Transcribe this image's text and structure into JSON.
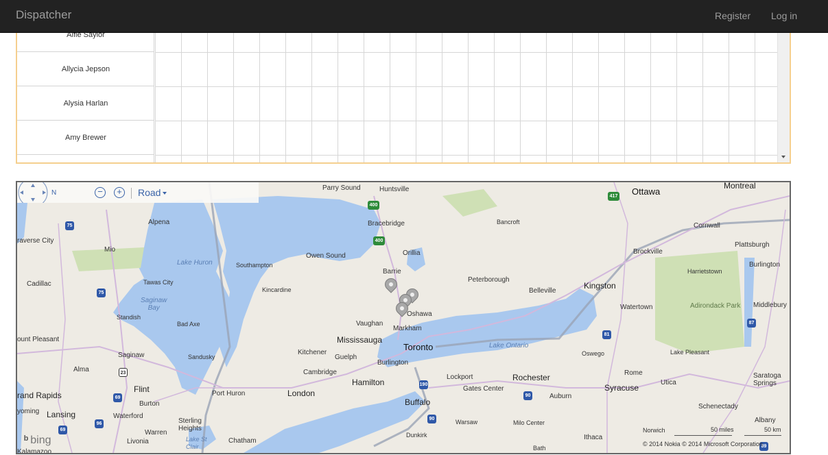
{
  "navbar": {
    "brand": "Dispatcher",
    "register": "Register",
    "login": "Log in"
  },
  "schedule": {
    "people": [
      "Alfie Saylor",
      "Allycia Jepson",
      "Alysia Harlan",
      "Amy Brewer"
    ]
  },
  "map": {
    "compass_label": "N",
    "zoom_out": "−",
    "zoom_in": "+",
    "map_type": "Road",
    "labels": {
      "parry_sound": "Parry Sound",
      "huntsville": "Huntsville",
      "ottawa": "Ottawa",
      "montreal": "Montreal",
      "alpena": "Alpena",
      "bracebridge": "Bracebridge",
      "bancroft": "Bancroft",
      "cornwall": "Cornwall",
      "traverse_city": "raverse City",
      "mio": "Mio",
      "orillia": "Orillia",
      "plattsburgh": "Plattsburgh",
      "lake_huron": "Lake Huron",
      "southampton": "Southampton",
      "owen_sound": "Owen Sound",
      "brockville": "Brockville",
      "burlington_vt": "Burlington",
      "cadillac": "Cadillac",
      "tawas_city": "Tawas City",
      "barrie": "Barrie",
      "peterborough": "Peterborough",
      "harrietstown": "Harrietstown",
      "kincardine": "Kincardine",
      "belleville": "Belleville",
      "kingston": "Kingston",
      "saginaw_bay": "Saginaw\nBay",
      "standish": "Standish",
      "oshawa": "Oshawa",
      "watertown": "Watertown",
      "adirondack": "Adirondack Park",
      "middlebury": "Middlebury",
      "bad_axe": "Bad Axe",
      "vaughan": "Vaughan",
      "markham": "Markham",
      "mount_pleasant": "ount Pleasant",
      "mississauga": "Mississauga",
      "lake_ontario": "Lake Ontario",
      "toronto": "Toronto",
      "oswego": "Oswego",
      "saginaw": "Saginaw",
      "sandusky": "Sandusky",
      "kitchener": "Kitchener",
      "guelph": "Guelph",
      "lake_pleasant": "Lake Pleasant",
      "alma": "Alma",
      "burlington_on": "Burlington",
      "cambridge": "Cambridge",
      "rome": "Rome",
      "saratoga": "Saratoga\nSprings",
      "utica": "Utica",
      "hamilton": "Hamilton",
      "lockport": "Lockport",
      "rochester": "Rochester",
      "flint": "Flint",
      "grand_rapids": "rand Rapids",
      "port_huron": "Port Huron",
      "london": "London",
      "gates_center": "Gates Center",
      "syracuse": "Syracuse",
      "burton": "Burton",
      "buffalo": "Buffalo",
      "auburn": "Auburn",
      "schenectady": "Schenectady",
      "wyoming": "yoming",
      "lansing": "Lansing",
      "waterford": "Waterford",
      "sterling_heights": "Sterling\nHeights",
      "warsaw": "Warsaw",
      "milo_center": "Milo Center",
      "albany": "Albany",
      "warren": "Warren",
      "dunkirk": "Dunkirk",
      "ithaca": "Ithaca",
      "norwich": "Norwich",
      "livonia": "Livonia",
      "chatham": "Chatham",
      "lake_st_clair": "Lake St\nClair",
      "kalamazoo": "Kalamazoo",
      "bath": "Bath"
    },
    "shields": [
      "75",
      "75",
      "400",
      "400",
      "417",
      "81",
      "87",
      "23",
      "69",
      "69",
      "96",
      "190",
      "90",
      "90",
      "89",
      "87"
    ],
    "bing": "bing",
    "scale_miles": "50 miles",
    "scale_km": "50 km",
    "copyright": "© 2014 Nokia    © 2014 Microsoft Corporation"
  }
}
